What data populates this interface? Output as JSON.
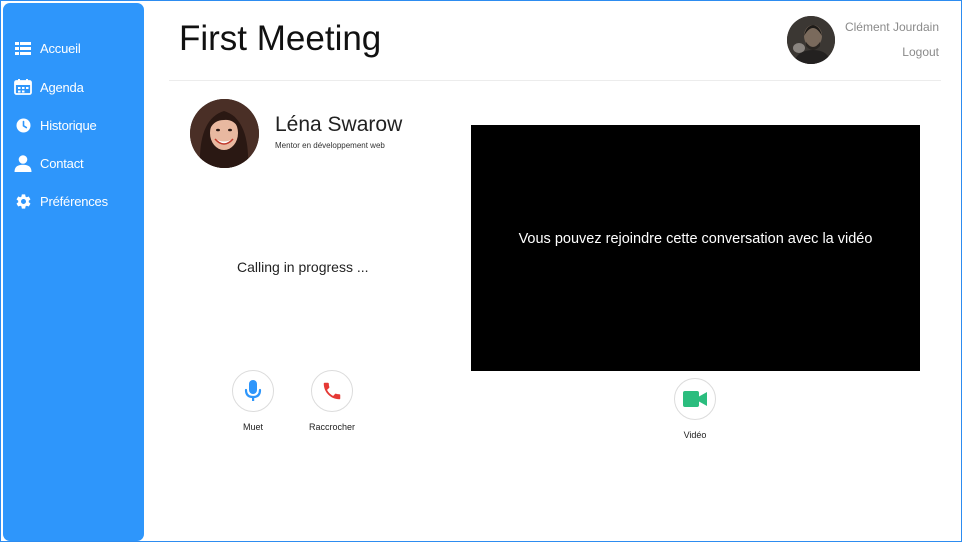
{
  "sidebar": {
    "items": [
      {
        "label": "Accueil",
        "icon": "list-icon"
      },
      {
        "label": "Agenda",
        "icon": "calendar-icon"
      },
      {
        "label": "Historique",
        "icon": "clock-icon"
      },
      {
        "label": "Contact",
        "icon": "person-icon"
      },
      {
        "label": "Préférences",
        "icon": "gear-icon"
      }
    ]
  },
  "header": {
    "title": "First Meeting",
    "user_name": "Clément Jourdain",
    "logout_label": "Logout"
  },
  "contact": {
    "name": "Léna Swarow",
    "role": "Mentor en développement web"
  },
  "call": {
    "status": "Calling in progress ...",
    "mute_label": "Muet",
    "hangup_label": "Raccrocher",
    "video_label": "Vidéo"
  },
  "video": {
    "message": "Vous pouvez rejoindre cette conversation avec la vidéo"
  },
  "colors": {
    "sidebar_bg": "#2e96fb",
    "mic": "#2e96fb",
    "hangup": "#e53935",
    "video": "#2bbd7e"
  }
}
